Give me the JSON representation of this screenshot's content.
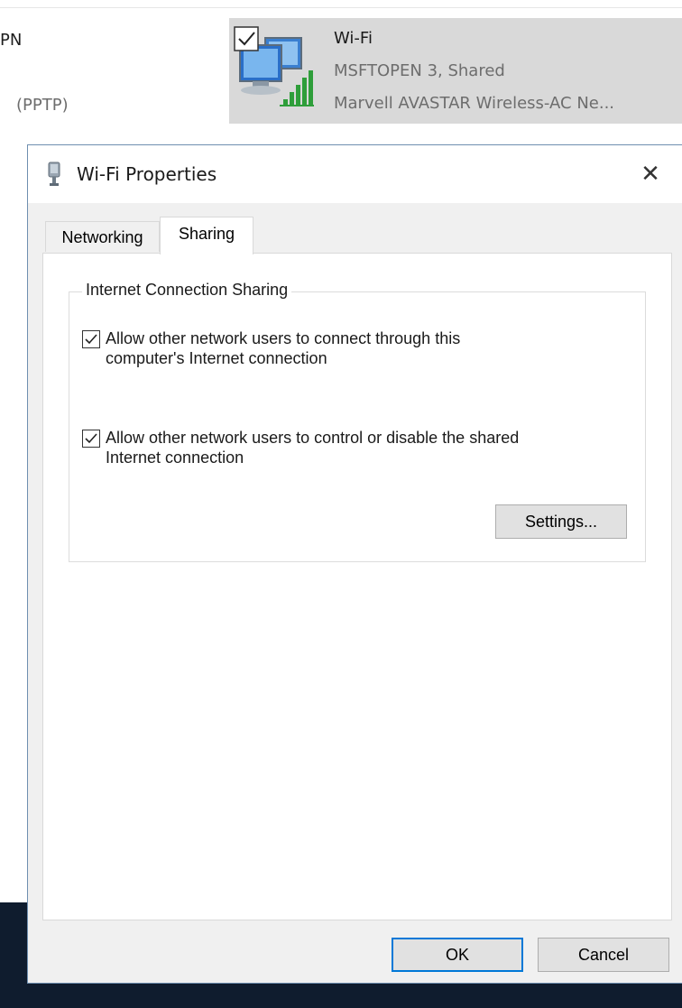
{
  "background": {
    "left_text_top": "PN",
    "left_text_bottom": "(PPTP)"
  },
  "adapter": {
    "name": "Wi-Fi",
    "status": "MSFTOPEN  3, Shared",
    "device": "Marvell AVASTAR Wireless-AC Ne...",
    "checked": true,
    "icon": "network-adapter-wifi-icon"
  },
  "dialog": {
    "title": "Wi-Fi Properties",
    "close_label": "✕",
    "tabs": [
      {
        "label": "Networking",
        "selected": false
      },
      {
        "label": "Sharing",
        "selected": true
      }
    ],
    "group": {
      "title": "Internet Connection Sharing",
      "options": [
        {
          "label": "Allow other network users to connect through this computer's Internet connection",
          "checked": true
        },
        {
          "label": "Allow other network users to control or disable the shared Internet connection",
          "checked": true
        }
      ],
      "settings_label": "Settings..."
    },
    "ok_label": "OK",
    "cancel_label": "Cancel"
  },
  "colors": {
    "accent": "#0078d7",
    "selection": "#d9d9d9",
    "taskbar": "#0f1c2e"
  }
}
